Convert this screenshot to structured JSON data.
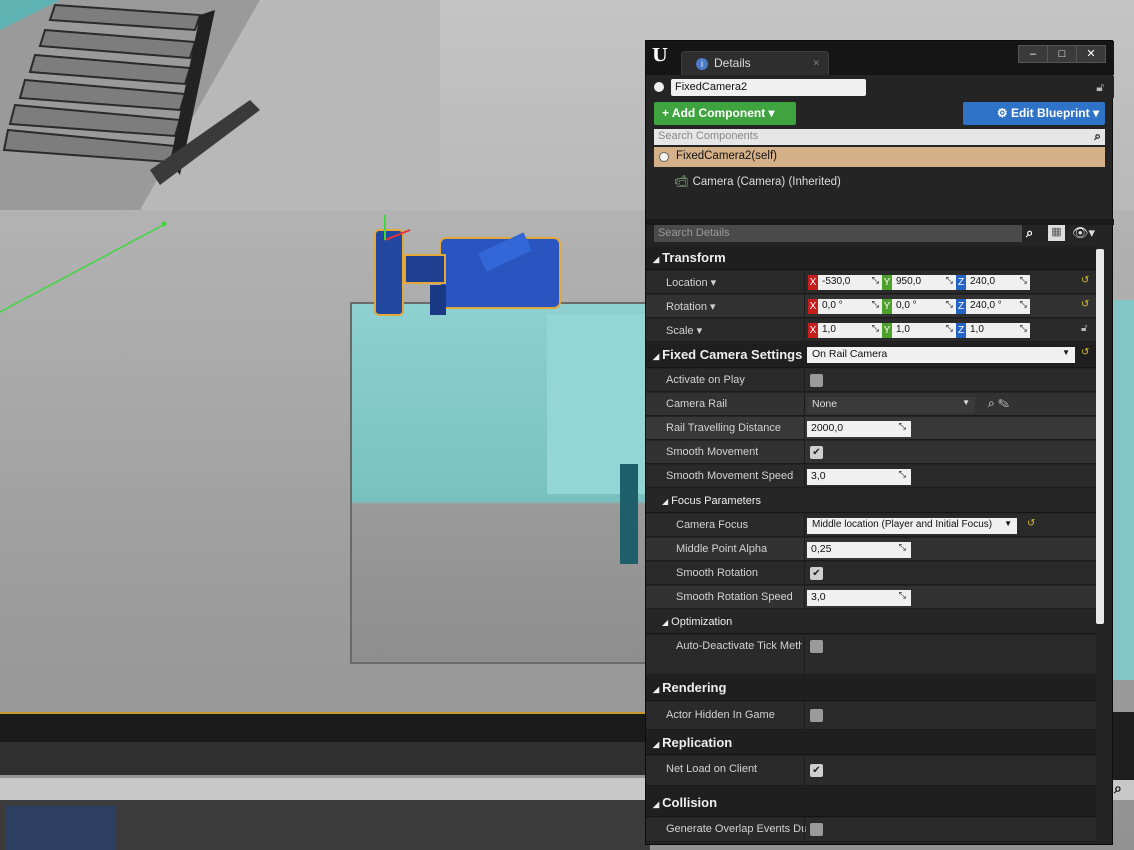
{
  "panel": {
    "tab_label": "Details",
    "window_controls": [
      "–",
      "□",
      "✕"
    ],
    "actor_name": "FixedCamera2",
    "add_component": "+ Add Component",
    "edit_blueprint": "Edit Blueprint",
    "search_components_placeholder": "Search Components",
    "components": [
      "FixedCamera2(self)",
      "Camera (Camera) (Inherited)"
    ],
    "search_details_placeholder": "Search Details"
  },
  "transform": {
    "title": "Transform",
    "location": {
      "label": "Location",
      "x": "-530,0",
      "y": "950,0",
      "z": "240,0"
    },
    "rotation": {
      "label": "Rotation",
      "x": "0,0 °",
      "y": "0,0 °",
      "z": "240,0 °"
    },
    "scale": {
      "label": "Scale",
      "x": "1,0",
      "y": "1,0",
      "z": "1,0"
    }
  },
  "fixed_camera": {
    "title": "Fixed Camera Settings",
    "mode": "On Rail Camera",
    "activate_on_play_label": "Activate on Play",
    "activate_on_play": false,
    "camera_rail_label": "Camera Rail",
    "camera_rail": "None",
    "rail_distance_label": "Rail Travelling Distance",
    "rail_distance": "2000,0",
    "smooth_movement_label": "Smooth Movement",
    "smooth_movement": true,
    "smooth_movement_speed_label": "Smooth Movement Speed",
    "smooth_movement_speed": "3,0",
    "focus_title": "Focus Parameters",
    "camera_focus_label": "Camera Focus",
    "camera_focus": "Middle location (Player and Initial Focus)",
    "middle_point_alpha_label": "Middle Point Alpha",
    "middle_point_alpha": "0,25",
    "smooth_rotation_label": "Smooth Rotation",
    "smooth_rotation": true,
    "smooth_rotation_speed_label": "Smooth Rotation Speed",
    "smooth_rotation_speed": "3,0",
    "optimization_title": "Optimization",
    "auto_deactivate_label": "Auto-Deactivate Tick Metho",
    "auto_deactivate": false
  },
  "rendering": {
    "title": "Rendering",
    "actor_hidden_label": "Actor Hidden In Game",
    "actor_hidden": false
  },
  "replication": {
    "title": "Replication",
    "net_load_label": "Net Load on Client",
    "net_load": true
  },
  "collision": {
    "title": "Collision",
    "overlap_label": "Generate Overlap Events Durin",
    "overlap": false
  },
  "colors": {
    "accent_green": "#3fa43f",
    "accent_blue": "#2e73c8",
    "selected_row": "#d5b189",
    "axis_x": "#c3201d",
    "axis_y": "#4ea02c",
    "axis_z": "#2563c5"
  }
}
